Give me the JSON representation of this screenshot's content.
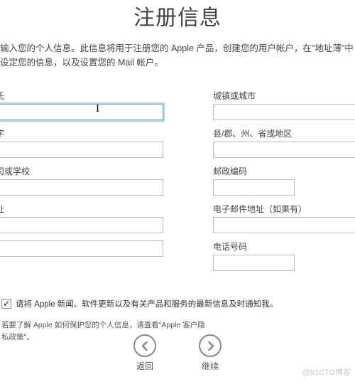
{
  "heading": "注册信息",
  "intro": "输入您的个人信息。此信息将用于注册您的 Apple 产品，创建您的用户帐户，在\"地址薄\"中设定您的信息，以及设置您的 Mail 帐户。",
  "left_fields": {
    "surname": {
      "label": "氏",
      "value": ""
    },
    "given_name": {
      "label": "字",
      "value": ""
    },
    "company": {
      "label": "司或学校",
      "value": ""
    },
    "address": {
      "label": "址",
      "value": ""
    },
    "address2": {
      "label": "",
      "value": ""
    }
  },
  "right_fields": {
    "city": {
      "label": "城镇或城市",
      "value": ""
    },
    "region": {
      "label": "县/郡、州、省或地区",
      "value": ""
    },
    "postal": {
      "label": "邮政编码",
      "value": ""
    },
    "email": {
      "label": "电子邮件地址（如果有）",
      "value": ""
    },
    "phone": {
      "label": "电话号码",
      "value": ""
    }
  },
  "checkbox": {
    "checked": true,
    "label": "请将 Apple 新闻、软件更新以及有关产品和服务的最新信息及时通知我。"
  },
  "privacy_note_line1": "若要了解 Apple 如何保护您的个人信息，请查看\"Apple 客户隐",
  "privacy_note_line2": "私政策\"。",
  "nav": {
    "back": "返回",
    "continue": "继续"
  },
  "watermark": "@51CTO博客"
}
